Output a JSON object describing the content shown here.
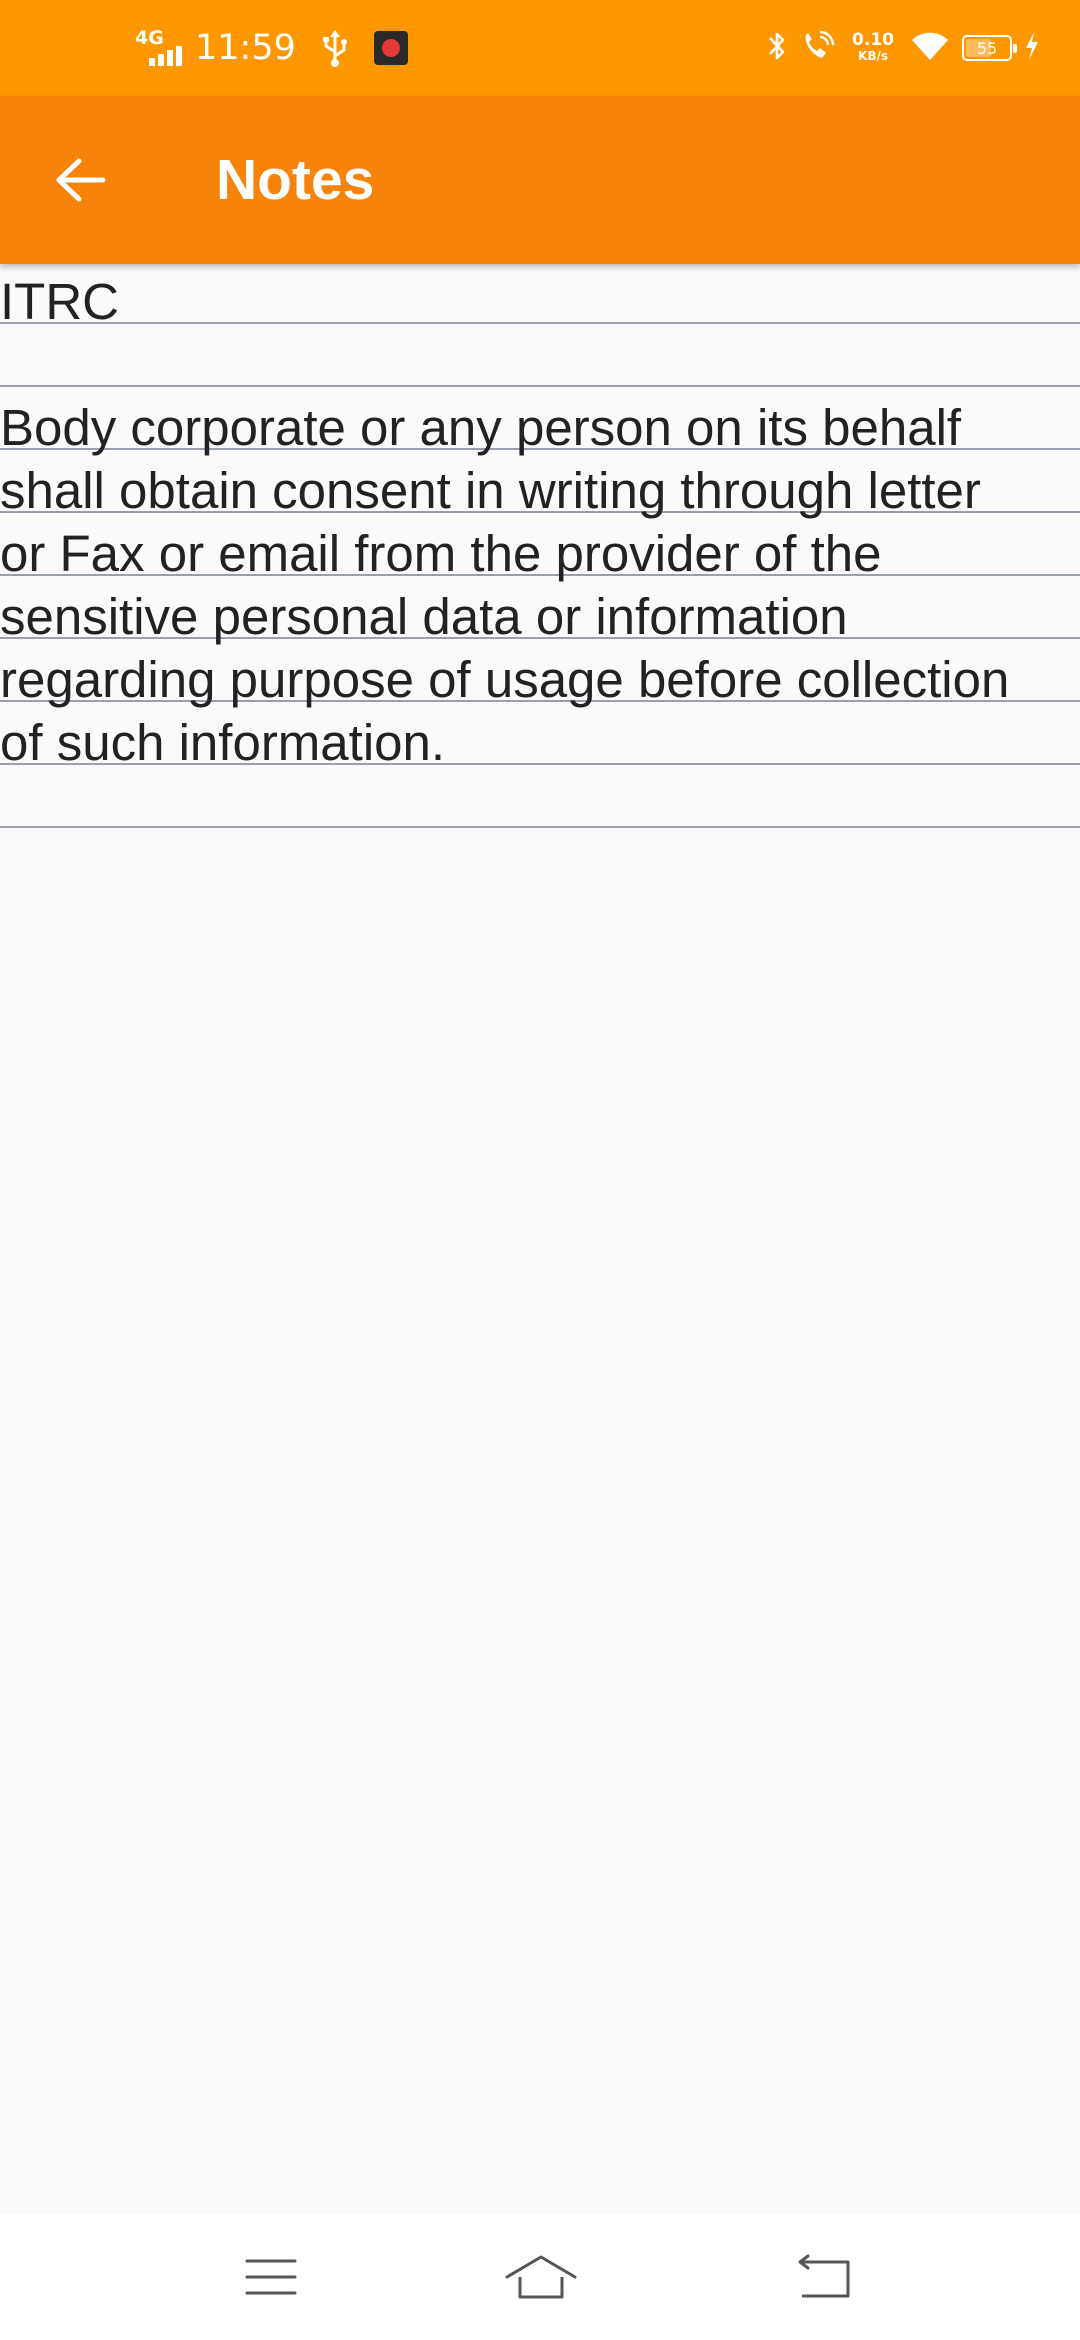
{
  "status_bar": {
    "network_type": "4G",
    "time": "11:59",
    "net_speed_value": "0.10",
    "net_speed_unit": "KB/s",
    "battery_level": "55",
    "icons": [
      "signal-icon",
      "usb-icon",
      "app-notification-icon",
      "bluetooth-icon",
      "wifi-calling-icon",
      "wifi-icon",
      "battery-icon",
      "charging-icon"
    ]
  },
  "app_bar": {
    "title": "Notes",
    "back_icon": "back-arrow-icon"
  },
  "note": {
    "title": "ITRC",
    "body": "Body corporate or any person on its behalf\nshall obtain consent in writing through letter\nor Fax or email from the provider of the\nsensitive personal data or information\nregarding purpose of usage before collection\nof such information."
  },
  "nav_bar": {
    "icons": [
      "menu-icon",
      "home-icon",
      "back-icon"
    ]
  },
  "colors": {
    "status_bar": "#ff9800",
    "app_bar": "#f7830a",
    "background": "#fafafa",
    "rule_line": "#9aa0ab",
    "text": "#222222"
  }
}
